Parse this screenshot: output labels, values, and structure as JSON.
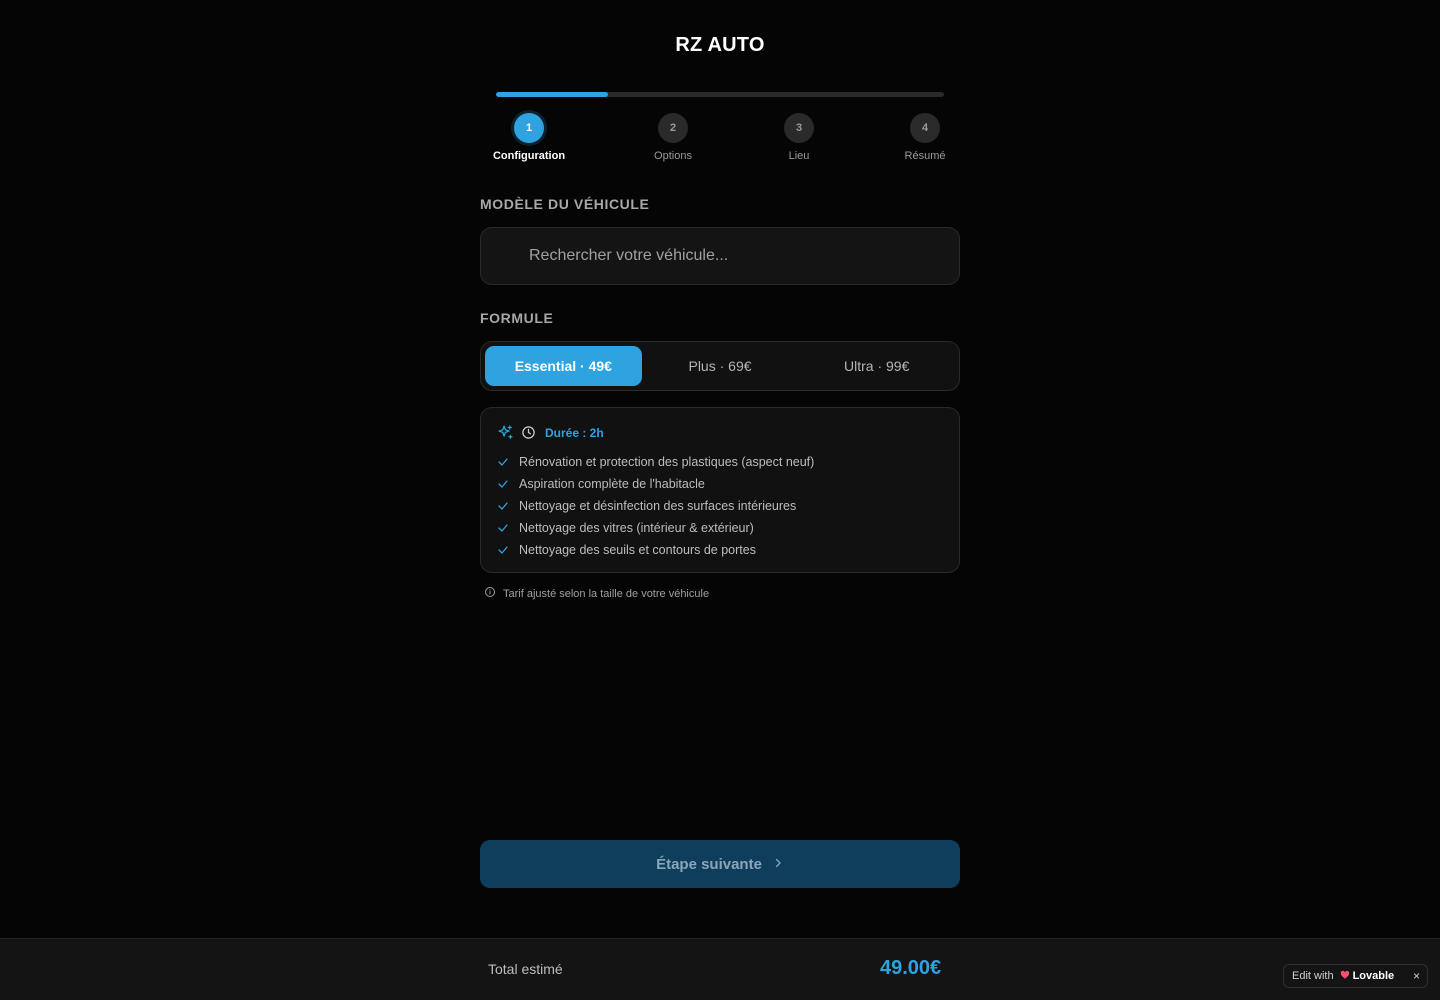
{
  "app": {
    "title": "RZ AUTO"
  },
  "progress": {
    "fraction": 0.25
  },
  "steps": [
    {
      "number": "1",
      "label": "Configuration",
      "active": true
    },
    {
      "number": "2",
      "label": "Options",
      "active": false
    },
    {
      "number": "3",
      "label": "Lieu",
      "active": false
    },
    {
      "number": "4",
      "label": "Résumé",
      "active": false
    }
  ],
  "vehicle": {
    "section_label": "MODÈLE DU VÉHICULE",
    "search_placeholder": "Rechercher votre véhicule...",
    "search_value": ""
  },
  "formula": {
    "section_label": "FORMULE",
    "options": [
      {
        "label": "Essential · 49€",
        "selected": true
      },
      {
        "label": "Plus · 69€",
        "selected": false
      },
      {
        "label": "Ultra · 99€",
        "selected": false
      }
    ]
  },
  "details": {
    "duration": "Durée : 2h",
    "icons": [
      "sparkles-icon",
      "clock-icon"
    ],
    "features": [
      "Rénovation et protection des plastiques (aspect neuf)",
      "Aspiration complète de l'habitacle",
      "Nettoyage et désinfection des surfaces intérieures",
      "Nettoyage des vitres (intérieur & extérieur)",
      "Nettoyage des seuils et contours de portes"
    ]
  },
  "note": "Tarif ajusté selon la taille de votre véhicule",
  "next_button": {
    "label": "Étape suivante",
    "icon": "chevron-right-icon"
  },
  "footer": {
    "label": "Total estimé",
    "total": "49.00€"
  },
  "badge": {
    "prefix": "Edit with",
    "brand": "Lovable",
    "close": "×"
  },
  "colors": {
    "accent": "#2ea3e0",
    "background": "#050505",
    "card": "#111111"
  }
}
